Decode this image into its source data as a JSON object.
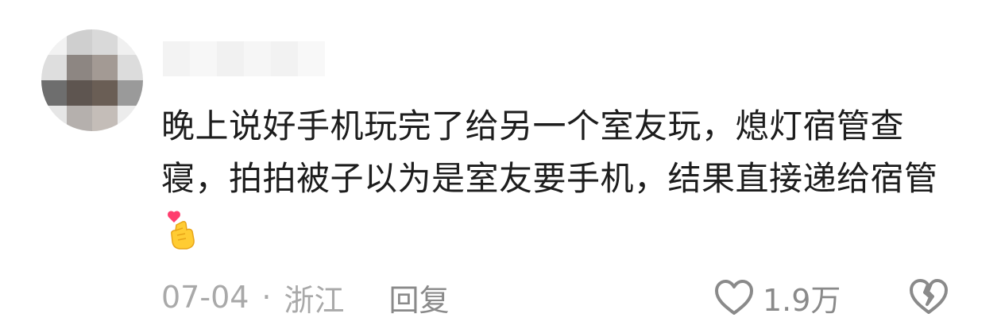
{
  "comment": {
    "text": "晚上说好手机玩完了给另一个室友玩，熄灯宿管查寝，拍拍被子以为是室友要手机，结果直接递给宿管",
    "emoji": "finger-heart-emoji"
  },
  "meta": {
    "date": "07-04",
    "separator": "·",
    "location": "浙江",
    "reply_label": "回复"
  },
  "actions": {
    "like_icon": "heart-outline-icon",
    "like_count": "1.9万",
    "dislike_icon": "broken-heart-outline-icon"
  },
  "colors": {
    "text": "#1d1d1d",
    "meta": "#a9a9a9",
    "action": "#8a8a8a"
  }
}
